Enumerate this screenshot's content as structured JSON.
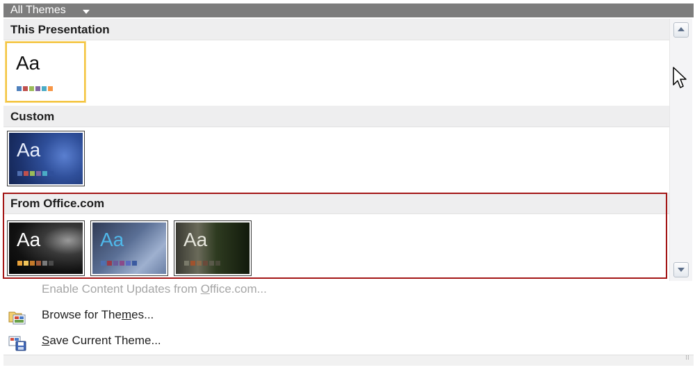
{
  "dropdown": {
    "title": "All Themes"
  },
  "sections": {
    "this_presentation": {
      "label": "This Presentation"
    },
    "custom": {
      "label": "Custom"
    },
    "office_com": {
      "label": "From Office.com"
    }
  },
  "thumb_text": "Aa",
  "themes": {
    "current": {
      "swatches": [
        "#4f81bd",
        "#c0504d",
        "#9bbb59",
        "#8064a2",
        "#4bacc6",
        "#f79646"
      ]
    },
    "custom": {
      "swatches": [
        "#4f6fb0",
        "#c0504d",
        "#9bbb59",
        "#8064a2",
        "#4bacc6",
        "#2f4f9a"
      ]
    },
    "office1": {
      "swatches": [
        "#e8a13a",
        "#f0c45a",
        "#c57a2a",
        "#a05a3a",
        "#7a7a7a",
        "#4a4a4a"
      ]
    },
    "office2": {
      "swatches": [
        "#4f6fb0",
        "#9a3a4a",
        "#6a5a9a",
        "#8a4a8a",
        "#5a6ac0",
        "#3a5aa0"
      ]
    },
    "office3": {
      "swatches": [
        "#7a7a6a",
        "#a0522d",
        "#8a6a4a",
        "#6a4a3a",
        "#5a5a4a",
        "#4a4a3a"
      ]
    }
  },
  "menu": {
    "enable_updates": {
      "before": "Enable Content Updates from ",
      "accel": "O",
      "after": "ffice.com..."
    },
    "browse": {
      "before": "Browse for The",
      "accel": "m",
      "after": "es..."
    },
    "save": {
      "before": "",
      "accel": "S",
      "after": "ave Current Theme..."
    }
  },
  "colors": {
    "selection_border": "#f4c542",
    "highlight_box": "#a31515",
    "header_bar": "#7d7d7d"
  }
}
